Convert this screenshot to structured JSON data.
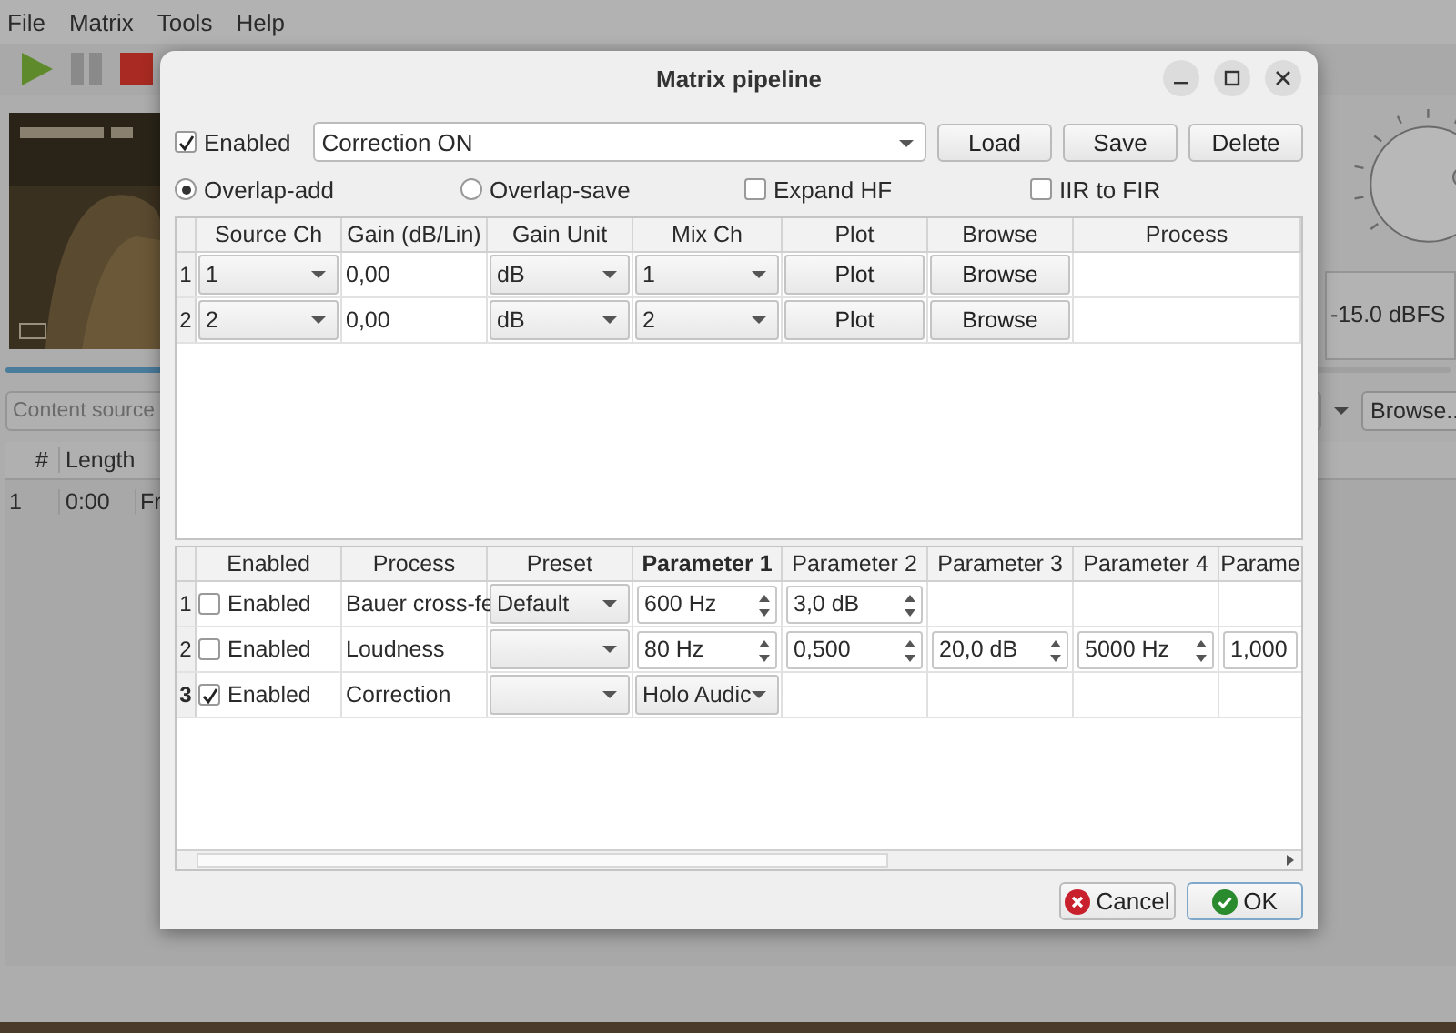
{
  "menu": [
    "File",
    "Matrix",
    "Tools",
    "Help"
  ],
  "toolbar": [
    {
      "kind": "play"
    },
    {
      "kind": "pause"
    },
    {
      "kind": "stop"
    }
  ],
  "main": {
    "position": {
      "level": 0.5
    },
    "content_source": {
      "placeholder": "Content source"
    },
    "browse": "Browse..",
    "level_reading": "-15.0 dBFS",
    "playlist": {
      "columns": [
        "#",
        "Length"
      ],
      "rows": [
        {
          "index": "1",
          "length": "0:00",
          "column_3": "Fr"
        }
      ]
    }
  },
  "dialog": {
    "title": "Matrix pipeline",
    "enabled": {
      "label": "Enabled",
      "checked": true
    },
    "preset": {
      "value": "Correction ON"
    },
    "actions": [
      "Load",
      "Save",
      "Delete"
    ],
    "options": [
      {
        "kind": "radio",
        "label": "Overlap-add",
        "selected": true
      },
      {
        "kind": "radio",
        "label": "Overlap-save",
        "selected": false
      },
      {
        "kind": "checkbox",
        "label": "Expand HF",
        "checked": false
      },
      {
        "kind": "checkbox",
        "label": "IIR to FIR",
        "checked": false
      }
    ],
    "matrix_table": {
      "columns": [
        "Source Ch",
        "Gain (dB/Lin)",
        "Gain Unit",
        "Mix Ch",
        "Plot",
        "Browse",
        "Process"
      ],
      "rows": [
        {
          "number": "1",
          "cells": [
            {
              "kind": "combo",
              "value": "1"
            },
            {
              "kind": "text",
              "value": "0,00"
            },
            {
              "kind": "combo",
              "value": "dB"
            },
            {
              "kind": "combo",
              "value": "1"
            },
            {
              "kind": "button",
              "label": "Plot"
            },
            {
              "kind": "button",
              "label": "Browse"
            },
            {
              "kind": "empty"
            }
          ]
        },
        {
          "number": "2",
          "cells": [
            {
              "kind": "combo",
              "value": "2"
            },
            {
              "kind": "text",
              "value": "0,00"
            },
            {
              "kind": "combo",
              "value": "dB"
            },
            {
              "kind": "combo",
              "value": "2"
            },
            {
              "kind": "button",
              "label": "Plot"
            },
            {
              "kind": "button",
              "label": "Browse"
            },
            {
              "kind": "empty"
            }
          ]
        }
      ]
    },
    "process_table": {
      "columns": [
        {
          "label": "Enabled",
          "current": false
        },
        {
          "label": "Process",
          "current": false
        },
        {
          "label": "Preset",
          "current": false
        },
        {
          "label": "Parameter 1",
          "current": true
        },
        {
          "label": "Parameter 2",
          "current": false
        },
        {
          "label": "Parameter 3",
          "current": false
        },
        {
          "label": "Parameter 4",
          "current": false
        },
        {
          "label": "Parame",
          "current": false
        }
      ],
      "rows": [
        {
          "number": "1",
          "current": false,
          "cells": [
            {
              "kind": "check",
              "label": "Enabled",
              "checked": false
            },
            {
              "kind": "text",
              "value": "Bauer cross-fe"
            },
            {
              "kind": "combo",
              "value": "Default"
            },
            {
              "kind": "spin",
              "value": "600 Hz"
            },
            {
              "kind": "spin",
              "value": "3,0 dB"
            },
            {
              "kind": "empty"
            },
            {
              "kind": "empty"
            },
            {
              "kind": "empty"
            }
          ]
        },
        {
          "number": "2",
          "current": false,
          "cells": [
            {
              "kind": "check",
              "label": "Enabled",
              "checked": false
            },
            {
              "kind": "text",
              "value": "Loudness"
            },
            {
              "kind": "combo"
            },
            {
              "kind": "spin",
              "value": "80 Hz"
            },
            {
              "kind": "spin",
              "value": "0,500"
            },
            {
              "kind": "spin",
              "value": "20,0 dB"
            },
            {
              "kind": "spin",
              "value": "5000 Hz"
            },
            {
              "kind": "field",
              "value": "1,000"
            }
          ]
        },
        {
          "number": "3",
          "current": true,
          "cells": [
            {
              "kind": "check",
              "label": "Enabled",
              "checked": true
            },
            {
              "kind": "text",
              "value": "Correction"
            },
            {
              "kind": "combo"
            },
            {
              "kind": "combo",
              "value": "Holo Audic"
            },
            {
              "kind": "empty"
            },
            {
              "kind": "empty"
            },
            {
              "kind": "empty"
            },
            {
              "kind": "empty"
            }
          ]
        }
      ]
    },
    "buttons": [
      {
        "kind": "cancel",
        "label": "Cancel",
        "default": false
      },
      {
        "kind": "ok",
        "label": "OK",
        "default": true
      }
    ]
  }
}
